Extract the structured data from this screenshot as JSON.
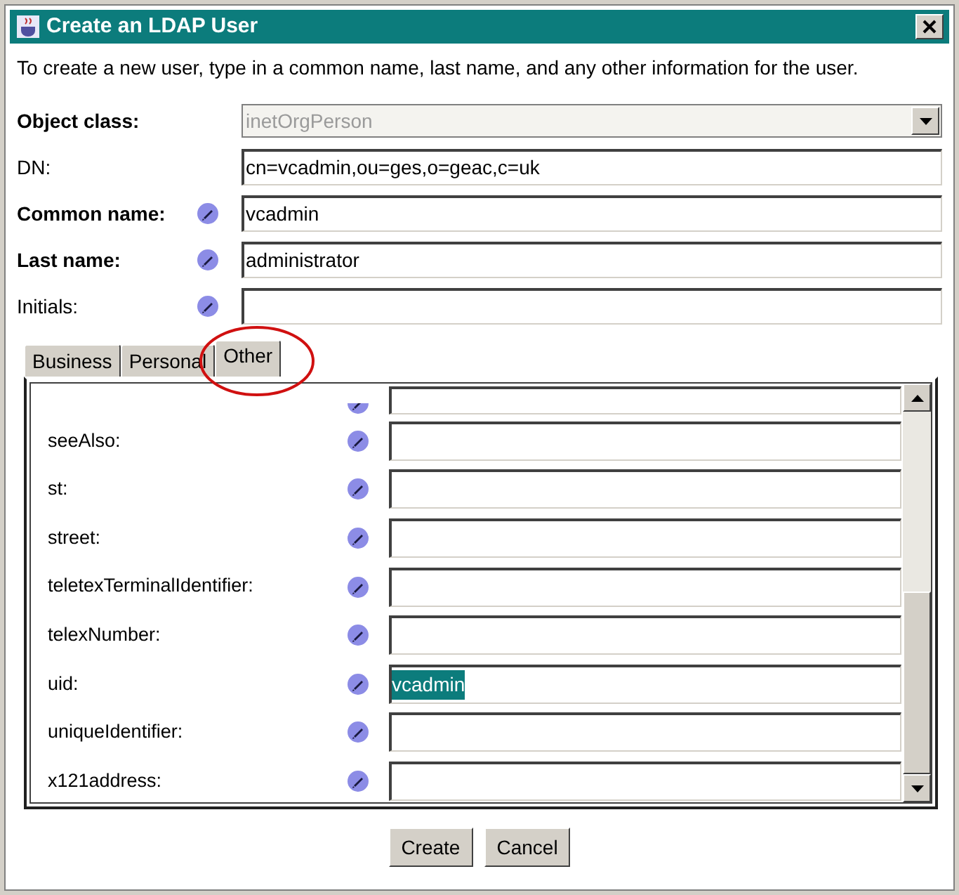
{
  "window": {
    "title": "Create an LDAP User"
  },
  "intro": "To create a new user, type in a common name, last name, and any other information for the user.",
  "form": [
    {
      "kind": "select",
      "label": "Object class:",
      "bold": true,
      "editable": false,
      "value": "inetOrgPerson",
      "disabled": true
    },
    {
      "kind": "text",
      "label": "DN:",
      "bold": false,
      "editable": false,
      "value": "cn=vcadmin,ou=ges,o=geac,c=uk"
    },
    {
      "kind": "text",
      "label": "Common name:",
      "bold": true,
      "editable": true,
      "value": "vcadmin"
    },
    {
      "kind": "text",
      "label": "Last name:",
      "bold": true,
      "editable": true,
      "value": "administrator"
    },
    {
      "kind": "text",
      "label": "Initials:",
      "bold": false,
      "editable": true
    }
  ],
  "tabs": [
    {
      "label": "Business",
      "selected": false,
      "circled": false
    },
    {
      "label": "Personal",
      "selected": false,
      "circled": false
    },
    {
      "label": "Other",
      "selected": true,
      "circled": true
    }
  ],
  "attributes": [
    {
      "label": "seeAlso:"
    },
    {
      "label": "st:"
    },
    {
      "label": "street:"
    },
    {
      "label": "teletexTerminalIdentifier:"
    },
    {
      "label": "telexNumber:"
    },
    {
      "label": "uid:",
      "value": "vcadmin",
      "highlighted": true
    },
    {
      "label": "uniqueIdentifier:"
    },
    {
      "label": "x121address:"
    }
  ],
  "buttons": [
    "Create",
    "Cancel"
  ]
}
